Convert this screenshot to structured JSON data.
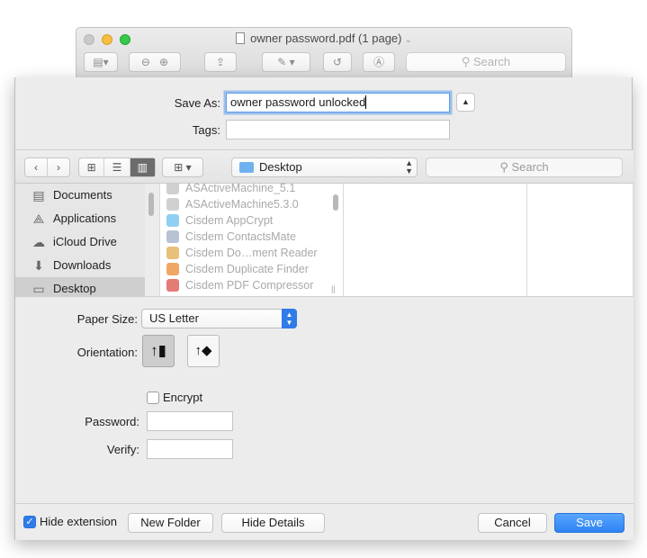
{
  "window": {
    "title": "owner password.pdf (1 page)",
    "toolbar_search_placeholder": "Search"
  },
  "save_as": {
    "label": "Save As:",
    "value": "owner password unlocked"
  },
  "tags": {
    "label": "Tags:",
    "value": ""
  },
  "navbar": {
    "location": "Desktop",
    "search_placeholder": "Search"
  },
  "sidebar": {
    "items": [
      {
        "label": "Documents",
        "icon": "documents-icon"
      },
      {
        "label": "Applications",
        "icon": "applications-icon"
      },
      {
        "label": "iCloud Drive",
        "icon": "cloud-icon"
      },
      {
        "label": "Downloads",
        "icon": "downloads-icon"
      },
      {
        "label": "Desktop",
        "icon": "desktop-icon",
        "selected": true
      }
    ]
  },
  "files": [
    {
      "name": "ASActiveMachine_5.1",
      "color": "#d0d0d0"
    },
    {
      "name": "ASActiveMachine5.3.0",
      "color": "#d0d0d0"
    },
    {
      "name": "Cisdem AppCrypt",
      "color": "#8fd0f2"
    },
    {
      "name": "Cisdem ContactsMate",
      "color": "#b7c3d3"
    },
    {
      "name": "Cisdem Do…ment Reader",
      "color": "#e7c07a"
    },
    {
      "name": "Cisdem Duplicate Finder",
      "color": "#f0a765"
    },
    {
      "name": "Cisdem PDF Compressor",
      "color": "#e47b74"
    }
  ],
  "options": {
    "paper_size_label": "Paper Size:",
    "paper_size_value": "US Letter",
    "orientation_label": "Orientation:",
    "encrypt_label": "Encrypt",
    "encrypt_checked": false,
    "password_label": "Password:",
    "verify_label": "Verify:"
  },
  "bottom": {
    "hide_extension_label": "Hide extension",
    "hide_extension_checked": true,
    "new_folder": "New Folder",
    "hide_details": "Hide Details",
    "cancel": "Cancel",
    "save": "Save"
  },
  "colors": {
    "accent": "#2f7bea",
    "focus_ring": "#5b9dea"
  }
}
